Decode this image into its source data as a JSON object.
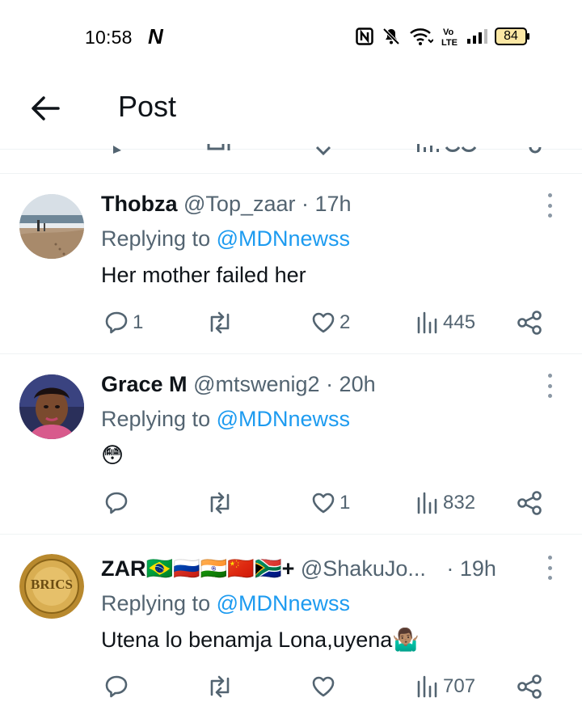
{
  "status_bar": {
    "time": "10:58",
    "netflix_glyph": "N",
    "icons": [
      "nfc-icon",
      "mute-icon",
      "wifi-icon",
      "volte-icon",
      "signal-icon"
    ],
    "volte_label": "Vo LTE",
    "battery_level": "84"
  },
  "header": {
    "title": "Post",
    "back_icon": "back-arrow-icon"
  },
  "replies": [
    {
      "name": "Thobza",
      "handle": "@Top_zaar",
      "time": "· 17h",
      "replying_prefix": "Replying to",
      "replying_to": "@MDNnewss",
      "text": "Her mother failed her",
      "reply_count": "1",
      "retweet_count": "",
      "like_count": "2",
      "view_count": "445"
    },
    {
      "name": "Grace M",
      "handle": "@mtswenig2",
      "time": "· 20h",
      "replying_prefix": "Replying to",
      "replying_to": "@MDNnewss",
      "text": "😳",
      "reply_count": "",
      "retweet_count": "",
      "like_count": "1",
      "view_count": "832"
    },
    {
      "name": "ZAR🇧🇷🇷🇺🇮🇳🇨🇳🇿🇦+",
      "handle": "@ShakuJo...",
      "time": "· 19h",
      "replying_prefix": "Replying to",
      "replying_to": "@MDNnewss",
      "text": "Utena lo benamja Lona,uyena🤷🏽‍♂️",
      "avatar_text": "BRICS",
      "reply_count": "",
      "retweet_count": "",
      "like_count": "",
      "view_count": "707"
    }
  ],
  "colors": {
    "link": "#1d9bf0",
    "muted": "#536471",
    "text": "#0f1419",
    "divider": "#eff3f4"
  }
}
